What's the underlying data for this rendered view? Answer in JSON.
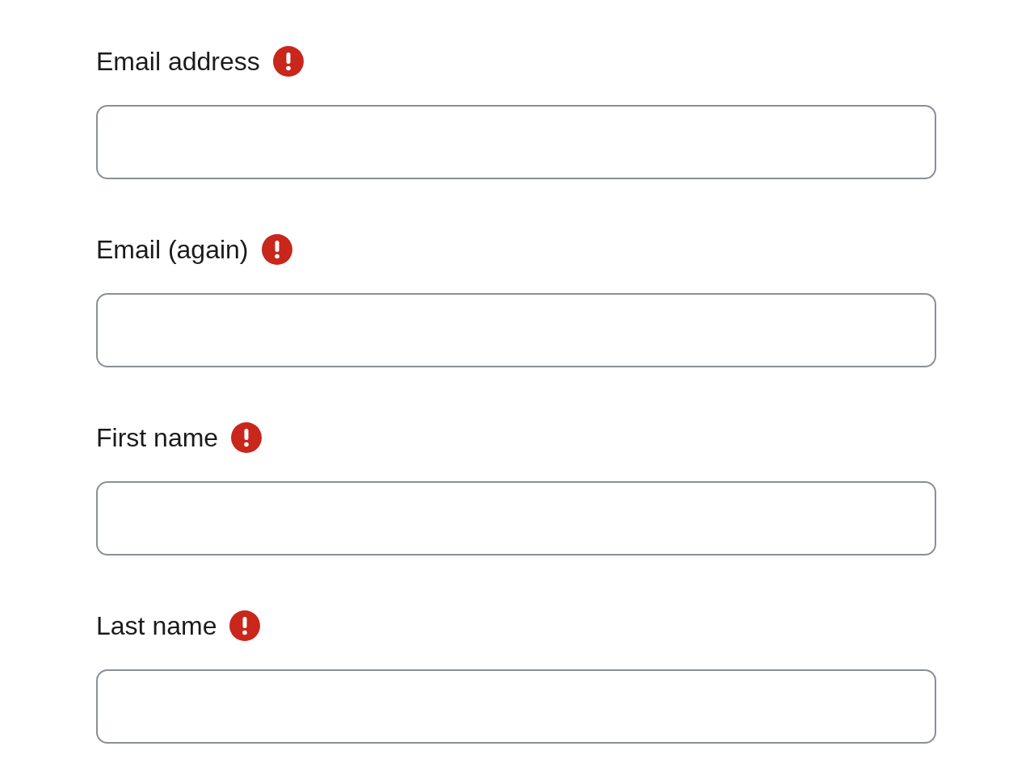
{
  "fields": [
    {
      "label": "Email address",
      "required": true
    },
    {
      "label": "Email (again)",
      "required": true
    },
    {
      "label": "First name",
      "required": true
    },
    {
      "label": "Last name",
      "required": true
    }
  ]
}
